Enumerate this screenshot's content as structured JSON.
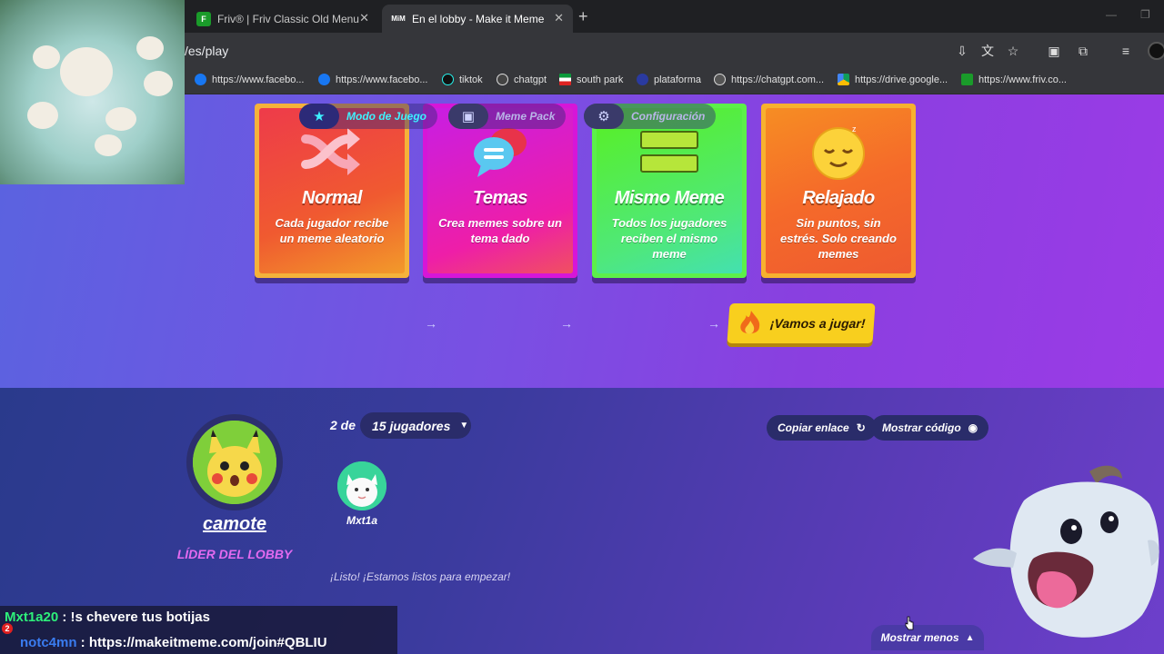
{
  "browser": {
    "tabs": [
      {
        "label": "Friv® | Friv Classic Old Menu",
        "favicon": "friv-logo-icon"
      },
      {
        "label": "En el lobby - Make it Meme",
        "favicon": "mim-logo-icon"
      }
    ],
    "url": "/es/play",
    "bookmarks": [
      "https://www.facebo...",
      "https://www.facebo...",
      "tiktok",
      "chatgpt",
      "south park",
      "plataforma",
      "https://chatgpt.com...",
      "https://drive.google...",
      "https://www.friv.co..."
    ]
  },
  "modes": [
    {
      "title": "Normal",
      "desc": "Cada jugador recibe un meme aleatorio",
      "icon": "shuffle-icon"
    },
    {
      "title": "Temas",
      "desc": "Crea memes sobre un tema dado",
      "icon": "chat-bubbles-icon"
    },
    {
      "title": "Mismo Meme",
      "desc": "Todos los jugadores reciben el mismo meme",
      "icon": "equals-icon"
    },
    {
      "title": "Relajado",
      "desc": "Sin puntos, sin estrés. Solo creando memes",
      "icon": "sleepy-face-icon"
    }
  ],
  "steps": [
    {
      "label": "Modo de Juego",
      "icon": "star-icon",
      "active": true
    },
    {
      "label": "Meme Pack",
      "icon": "box-icon",
      "active": false
    },
    {
      "label": "Configuración",
      "icon": "gear-icon",
      "active": false
    }
  ],
  "play_button": "¡Vamos a jugar!",
  "lobby": {
    "leader_name": "camote",
    "leader_role": "LÍDER DEL LOBBY",
    "count_prefix": "2 de",
    "max_players": "15 jugadores",
    "copy_link": "Copiar enlace",
    "show_code": "Mostrar código",
    "player2_name": "Mxt1a",
    "ready_message": "¡Listo! ¡Estamos listos para empezar!",
    "show_less": "Mostrar menos"
  },
  "chat": {
    "line1_user": "Mxt1a20",
    "line1_msg": " : !s chevere tus botijas",
    "line2_user": "notc4mn",
    "line2_msg": " : https://makeitmeme.com/join#QBLIU",
    "badge": "2"
  },
  "colors": {
    "accent_cyan": "#3df2ff",
    "leader_role": "#e36af0",
    "play_button": "#f8cf1e"
  }
}
